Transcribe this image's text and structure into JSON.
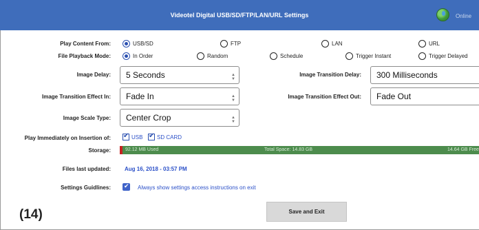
{
  "header": {
    "title": "Videotel Digital USB/SD/FTP/LAN/URL Settings",
    "status": "Online",
    "status_icon": "globe-icon",
    "background": "#3f6dbb"
  },
  "play_content": {
    "label": "Play Content From:",
    "options": [
      "USB/SD",
      "FTP",
      "LAN",
      "URL"
    ],
    "selected": "USB/SD"
  },
  "playback_mode": {
    "label": "File Playback Mode:",
    "options": [
      "In Order",
      "Random",
      "Schedule",
      "Trigger Instant",
      "Trigger Delayed"
    ],
    "selected": "In Order"
  },
  "image_delay": {
    "label": "Image Delay:",
    "value": "5 Seconds"
  },
  "transition_delay": {
    "label": "Image Transition Delay:",
    "value": "300 Milliseconds"
  },
  "effect_in": {
    "label": "Image Transition Effect In:",
    "value": "Fade In"
  },
  "effect_out": {
    "label": "Image Transition Effect Out:",
    "value": "Fade Out"
  },
  "scale_type": {
    "label": "Image Scale Type:",
    "value": "Center Crop"
  },
  "insertion": {
    "label": "Play Immediately on Insertion of:",
    "usb_label": "USB",
    "usb_checked": true,
    "sd_label": "SD CARD",
    "sd_checked": true
  },
  "storage": {
    "label": "Storage:",
    "used": "92.12 MB Used",
    "total": "Total Space: 14.83 GB",
    "free": "14.64 GB Free",
    "used_fraction": 0.006,
    "bar_color": "#4d8c4d",
    "used_color": "#c62222"
  },
  "files_updated": {
    "label": "Files last updated:",
    "value": "Aug 16, 2018 - 03:57 PM"
  },
  "guidelines": {
    "label": "Settings Guidlines:",
    "text": "Always show settings access instructions on exit",
    "checked": true
  },
  "save_button": "Save and Exit",
  "figure_label": "(14)"
}
